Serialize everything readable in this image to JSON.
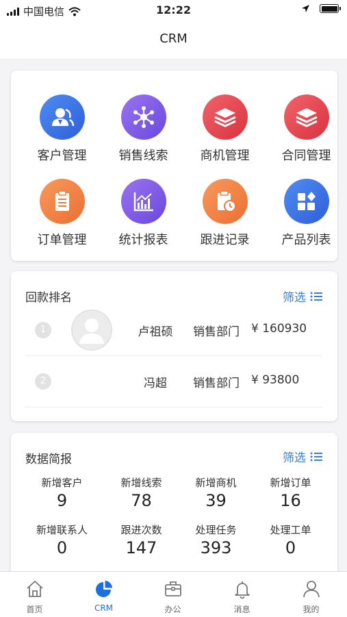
{
  "status_bar": {
    "carrier": "中国电信",
    "time": "12:22"
  },
  "header": {
    "title": "CRM"
  },
  "menu": {
    "items": [
      {
        "label": "客户管理",
        "icon": "customer-icon"
      },
      {
        "label": "销售线索",
        "icon": "lead-network-icon"
      },
      {
        "label": "商机管理",
        "icon": "layers-icon"
      },
      {
        "label": "合同管理",
        "icon": "layers-icon"
      },
      {
        "label": "订单管理",
        "icon": "clipboard-icon"
      },
      {
        "label": "统计报表",
        "icon": "chart-icon"
      },
      {
        "label": "跟进记录",
        "icon": "followup-clock-icon"
      },
      {
        "label": "产品列表",
        "icon": "product-grid-icon"
      }
    ]
  },
  "ranking": {
    "title": "回款排名",
    "filter_label": "筛选",
    "rows": [
      {
        "rank": "1",
        "name": "卢祖硕",
        "dept": "销售部门",
        "amount": "¥  160930"
      },
      {
        "rank": "2",
        "name": "冯超",
        "dept": "销售部门",
        "amount": "¥  93800"
      }
    ]
  },
  "summary": {
    "title": "数据简报",
    "filter_label": "筛选",
    "stats": [
      {
        "label": "新增客户",
        "value": "9"
      },
      {
        "label": "新增线索",
        "value": "78"
      },
      {
        "label": "新增商机",
        "value": "39"
      },
      {
        "label": "新增订单",
        "value": "16"
      },
      {
        "label": "新增联系人",
        "value": "0"
      },
      {
        "label": "跟进次数",
        "value": "147"
      },
      {
        "label": "处理任务",
        "value": "393"
      },
      {
        "label": "处理工单",
        "value": "0"
      }
    ]
  },
  "tabbar": {
    "items": [
      {
        "label": "首页",
        "icon": "home-icon"
      },
      {
        "label": "CRM",
        "icon": "pie-chart-icon",
        "active": true
      },
      {
        "label": "办公",
        "icon": "briefcase-icon"
      },
      {
        "label": "消息",
        "icon": "bell-icon"
      },
      {
        "label": "我的",
        "icon": "user-icon"
      }
    ]
  },
  "colors": {
    "accent": "#1e6fe0",
    "blue_icon": "#3f74e8",
    "purple_icon": "#7b5be6",
    "red_icon": "#e84752",
    "orange_icon": "#f2823f"
  }
}
